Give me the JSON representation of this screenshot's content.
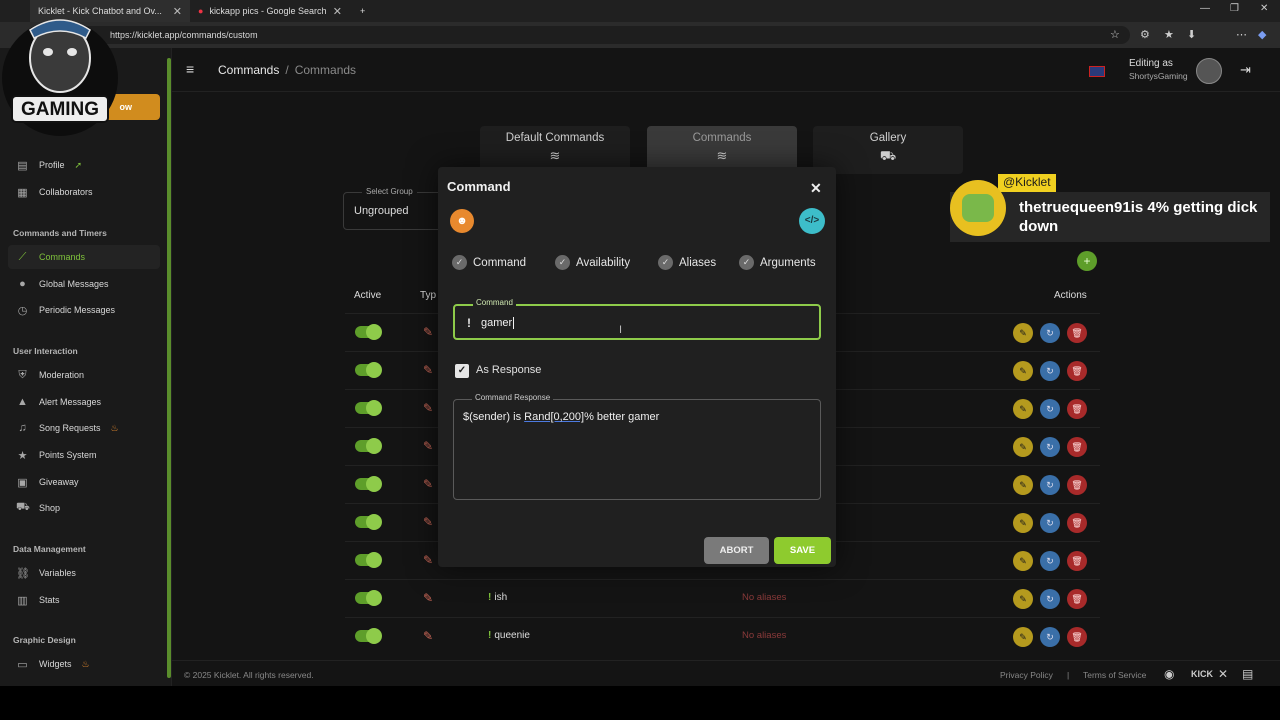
{
  "browser": {
    "tabs": [
      {
        "label": "Kicklet - Kick Chatbot and Ov..."
      },
      {
        "label": "kickapp pics - Google Search"
      }
    ],
    "new_tab": "+",
    "url": "https://kicklet.app/commands/custom"
  },
  "sidebar": {
    "follow_label": "ow",
    "items_top": [
      {
        "label": "Profile"
      },
      {
        "label": "Collaborators"
      }
    ],
    "sections": {
      "commands_timers": "Commands and Timers",
      "user_interaction": "User Interaction",
      "data_management": "Data Management",
      "graphic_design": "Graphic Design"
    },
    "items_commands": [
      {
        "label": "Commands"
      },
      {
        "label": "Global Messages"
      },
      {
        "label": "Periodic Messages"
      }
    ],
    "items_user": [
      {
        "label": "Moderation"
      },
      {
        "label": "Alert Messages"
      },
      {
        "label": "Song Requests"
      },
      {
        "label": "Points System"
      },
      {
        "label": "Giveaway"
      },
      {
        "label": "Shop"
      }
    ],
    "items_data": [
      {
        "label": "Variables"
      },
      {
        "label": "Stats"
      }
    ],
    "items_design": [
      {
        "label": "Widgets"
      }
    ]
  },
  "logo": {
    "text": "GAMING"
  },
  "header": {
    "breadcrumb_root": "Commands",
    "breadcrumb_sep": "/",
    "breadcrumb_current": "Commands",
    "editing_label": "Editing as",
    "editing_user": "ShortysGaming"
  },
  "nav_tabs": [
    {
      "label": "Default Commands"
    },
    {
      "label": "Commands"
    },
    {
      "label": "Gallery"
    }
  ],
  "select_group": {
    "label": "Select Group",
    "value": "Ungrouped"
  },
  "table": {
    "col_active": "Active",
    "col_type": "Typ",
    "col_actions": "Actions",
    "rows": [
      {
        "name": "",
        "alias": ""
      },
      {
        "name": "",
        "alias": ""
      },
      {
        "name": "",
        "alias": ""
      },
      {
        "name": "",
        "alias": ""
      },
      {
        "name": "",
        "alias": ""
      },
      {
        "name": "",
        "alias": ""
      },
      {
        "name": "",
        "alias": ""
      },
      {
        "name": "ish",
        "alias": "No aliases"
      },
      {
        "name": "queenie",
        "alias": "No aliases"
      }
    ]
  },
  "footer": {
    "copyright": "© 2025 Kicklet. All rights reserved.",
    "privacy": "Privacy Policy",
    "sep": "|",
    "terms": "Terms of Service",
    "kick": "KICK"
  },
  "modal": {
    "title": "Command",
    "tabs": [
      {
        "label": "Command"
      },
      {
        "label": "Availability"
      },
      {
        "label": "Aliases"
      },
      {
        "label": "Arguments"
      }
    ],
    "command_field_label": "Command",
    "command_prefix": "!",
    "command_value": "gamer",
    "as_response_label": "As Response",
    "response_label": "Command Response",
    "response_pre": "$(sender) is ",
    "response_func": "Rand[0,200]",
    "response_post": "% better gamer",
    "abort_label": "ABORT",
    "save_label": "SAVE"
  },
  "alert": {
    "handle": "@Kicklet",
    "message": "thetruequeen91is 4% getting dick down"
  },
  "colors": {
    "accent": "#8ecb4a",
    "save": "#8ecb2e",
    "code": "#3dbdc9",
    "edit": "#b59a1e",
    "refresh": "#3a6fa8",
    "delete": "#a82a2a"
  }
}
